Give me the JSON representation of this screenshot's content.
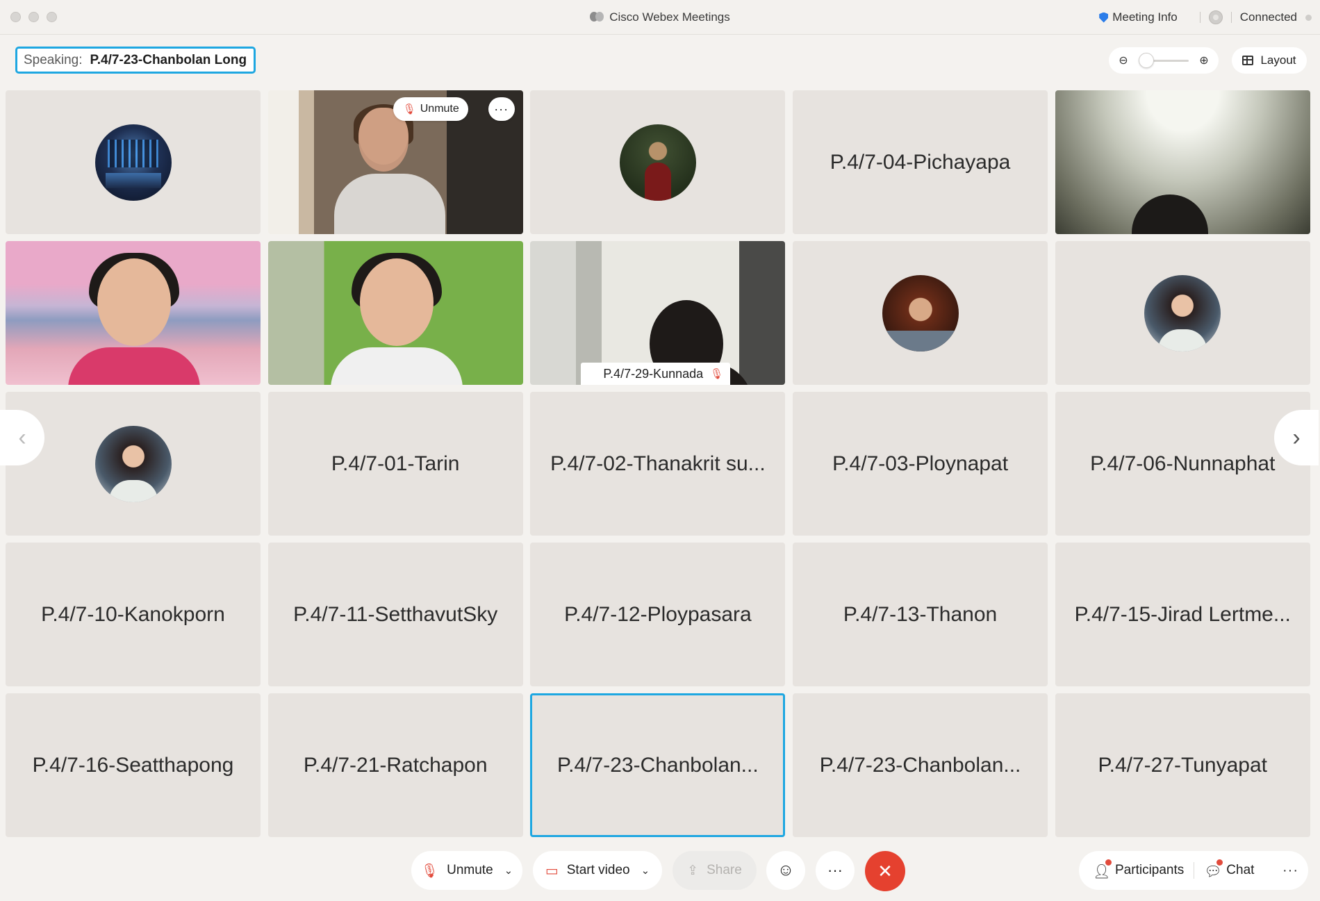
{
  "window": {
    "title": "Cisco Webex Meetings",
    "meeting_info": "Meeting Info",
    "status": "Connected"
  },
  "speaking": {
    "label": "Speaking:",
    "name": "P.4/7-23-Chanbolan Long"
  },
  "toolbar_top": {
    "layout_label": "Layout"
  },
  "tiles": [
    {
      "type": "avatar",
      "avatar": "server-room"
    },
    {
      "type": "video",
      "video": "teacher"
    },
    {
      "type": "avatar",
      "avatar": "forest-woman"
    },
    {
      "type": "name",
      "name": "P.4/7-04-Pichayapa"
    },
    {
      "type": "video",
      "video": "blurred-room"
    },
    {
      "type": "video",
      "video": "beach-student"
    },
    {
      "type": "video",
      "video": "green-wall-student"
    },
    {
      "type": "video",
      "video": "room-student",
      "name": "P.4/7-29-Kunnada"
    },
    {
      "type": "avatar",
      "avatar": "curly-hair-woman"
    },
    {
      "type": "avatar",
      "avatar": "woman-portrait"
    },
    {
      "type": "avatar",
      "avatar": "woman-portrait"
    },
    {
      "type": "name",
      "name": "P.4/7-01-Tarin"
    },
    {
      "type": "name",
      "name": "P.4/7-02-Thanakrit su..."
    },
    {
      "type": "name",
      "name": "P.4/7-03-Ploynapat"
    },
    {
      "type": "name",
      "name": "P.4/7-06-Nunnaphat"
    },
    {
      "type": "name",
      "name": "P.4/7-10-Kanokporn"
    },
    {
      "type": "name",
      "name": "P.4/7-11-SetthavutSky"
    },
    {
      "type": "name",
      "name": "P.4/7-12-Ploypasara"
    },
    {
      "type": "name",
      "name": "P.4/7-13-Thanon"
    },
    {
      "type": "name",
      "name": "P.4/7-15-Jirad Lertme..."
    },
    {
      "type": "name",
      "name": "P.4/7-16-Seatthapong"
    },
    {
      "type": "name",
      "name": "P.4/7-21-Ratchapon"
    },
    {
      "type": "name",
      "name": "P.4/7-23-Chanbolan...",
      "active": true
    },
    {
      "type": "name",
      "name": "P.4/7-23-Chanbolan..."
    },
    {
      "type": "name",
      "name": "P.4/7-27-Tunyapat"
    }
  ],
  "tile_actions": {
    "unmute_label": "Unmute",
    "more_label": "···"
  },
  "controls": {
    "unmute_label": "Unmute",
    "start_video_label": "Start video",
    "share_label": "Share",
    "more_label": "···",
    "participants_label": "Participants",
    "chat_label": "Chat",
    "overflow_label": "···"
  },
  "colors": {
    "accent": "#1ea7e1",
    "leave": "#e5412f",
    "muted": "#e24b3c"
  }
}
